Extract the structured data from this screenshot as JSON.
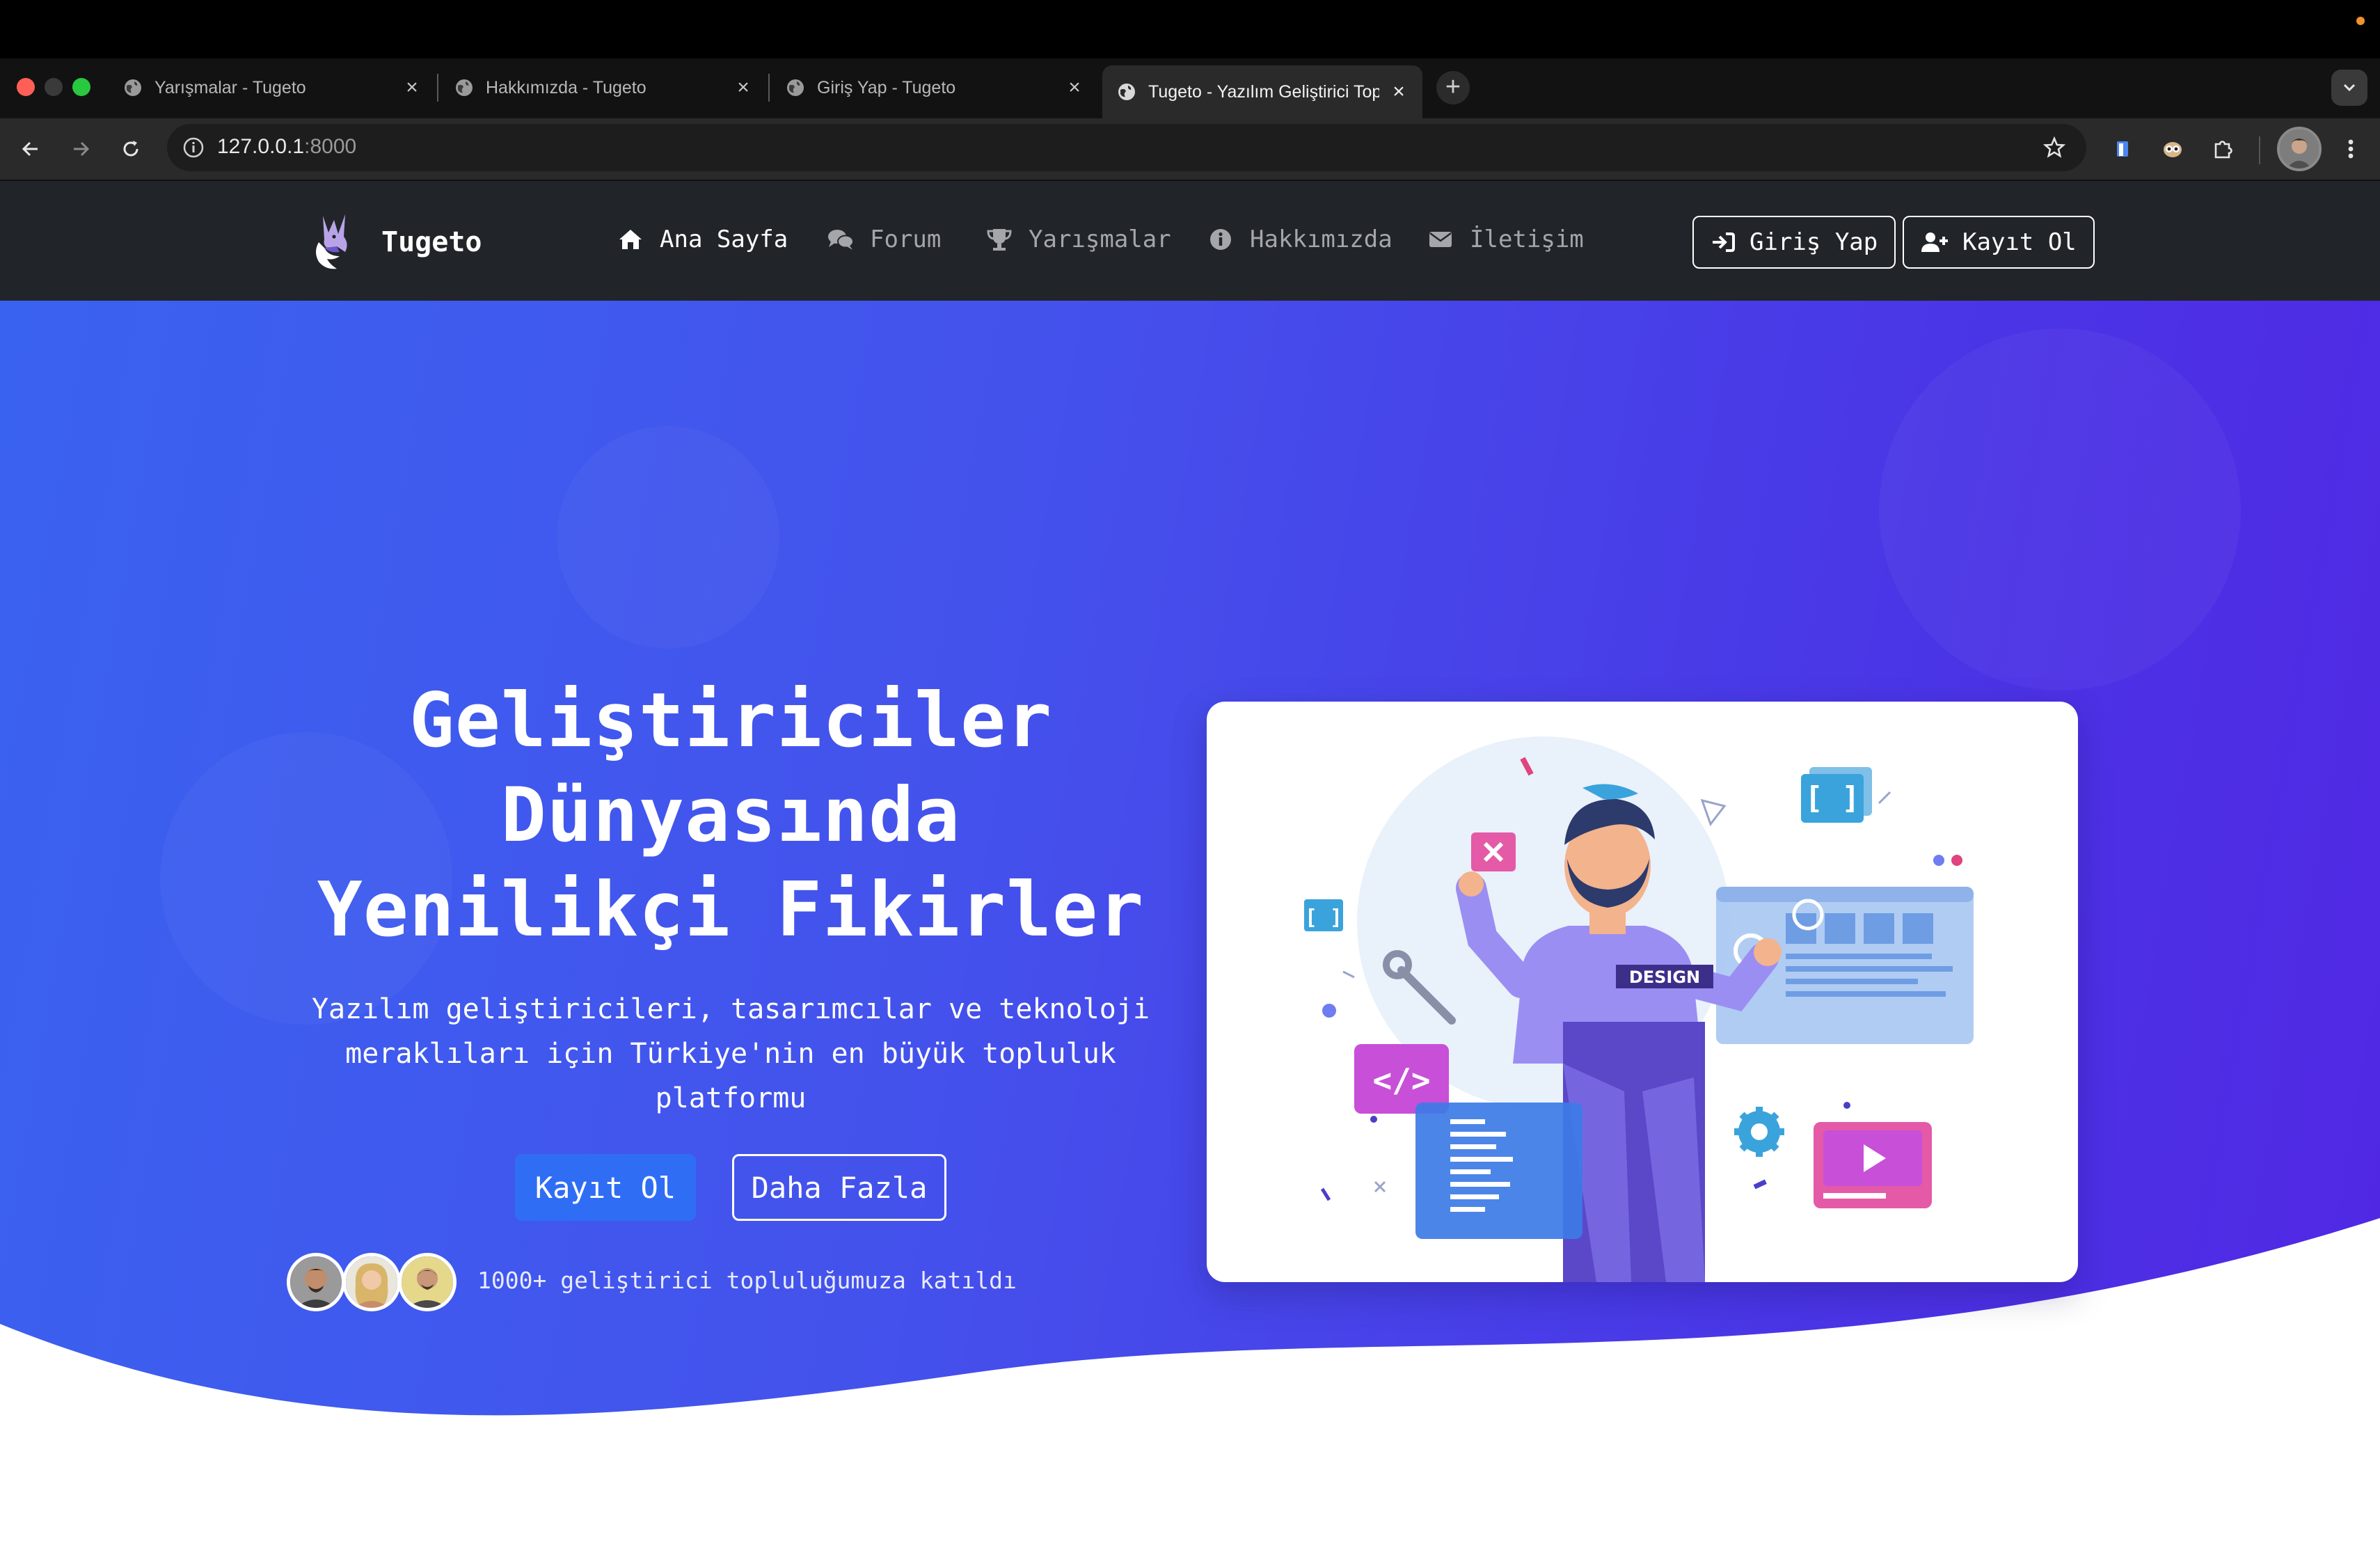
{
  "browser": {
    "tabs": [
      {
        "title": "Yarışmalar - Tugeto",
        "active": false
      },
      {
        "title": "Hakkımızda - Tugeto",
        "active": false
      },
      {
        "title": "Giriş Yap - Tugeto",
        "active": false
      },
      {
        "title": "Tugeto - Yazılım Geliştirici Top",
        "active": true
      }
    ],
    "new_tab_label": "+",
    "close_glyph": "×",
    "url_host": "127.0.0.1",
    "url_port": ":8000"
  },
  "navbar": {
    "brand": "Tugeto",
    "links": [
      {
        "label": "Ana Sayfa",
        "icon": "home-icon",
        "active": true
      },
      {
        "label": "Forum",
        "icon": "comments-icon",
        "active": false
      },
      {
        "label": "Yarışmalar",
        "icon": "trophy-icon",
        "active": false
      },
      {
        "label": "Hakkımızda",
        "icon": "info-icon",
        "active": false
      },
      {
        "label": "İletişim",
        "icon": "envelope-icon",
        "active": false
      }
    ],
    "login_label": "Giriş Yap",
    "register_label": "Kayıt Ol"
  },
  "hero": {
    "title_line1": "Geliştiriciler",
    "title_line2": "Dünyasında",
    "title_line3": "Yenilikçi Fikirler",
    "subtitle_line1": "Yazılım geliştiricileri, tasarımcılar ve teknoloji",
    "subtitle_line2": "meraklıları için Türkiye'nin en büyük topluluk",
    "subtitle_line3": "platformu",
    "primary_button": "Kayıt Ol",
    "secondary_button": "Daha Fazla",
    "community_text": "1000+ geliştirici topluluğumuza katıldı"
  },
  "illustration": {
    "badge_text": "DESIGN",
    "bracket_text": "[ ]",
    "code_text": "</>"
  },
  "colors": {
    "hero_gradient_start": "#3a62f0",
    "hero_gradient_end": "#5127e4",
    "navbar_bg": "#212529",
    "primary_button": "#2f6ef4"
  }
}
